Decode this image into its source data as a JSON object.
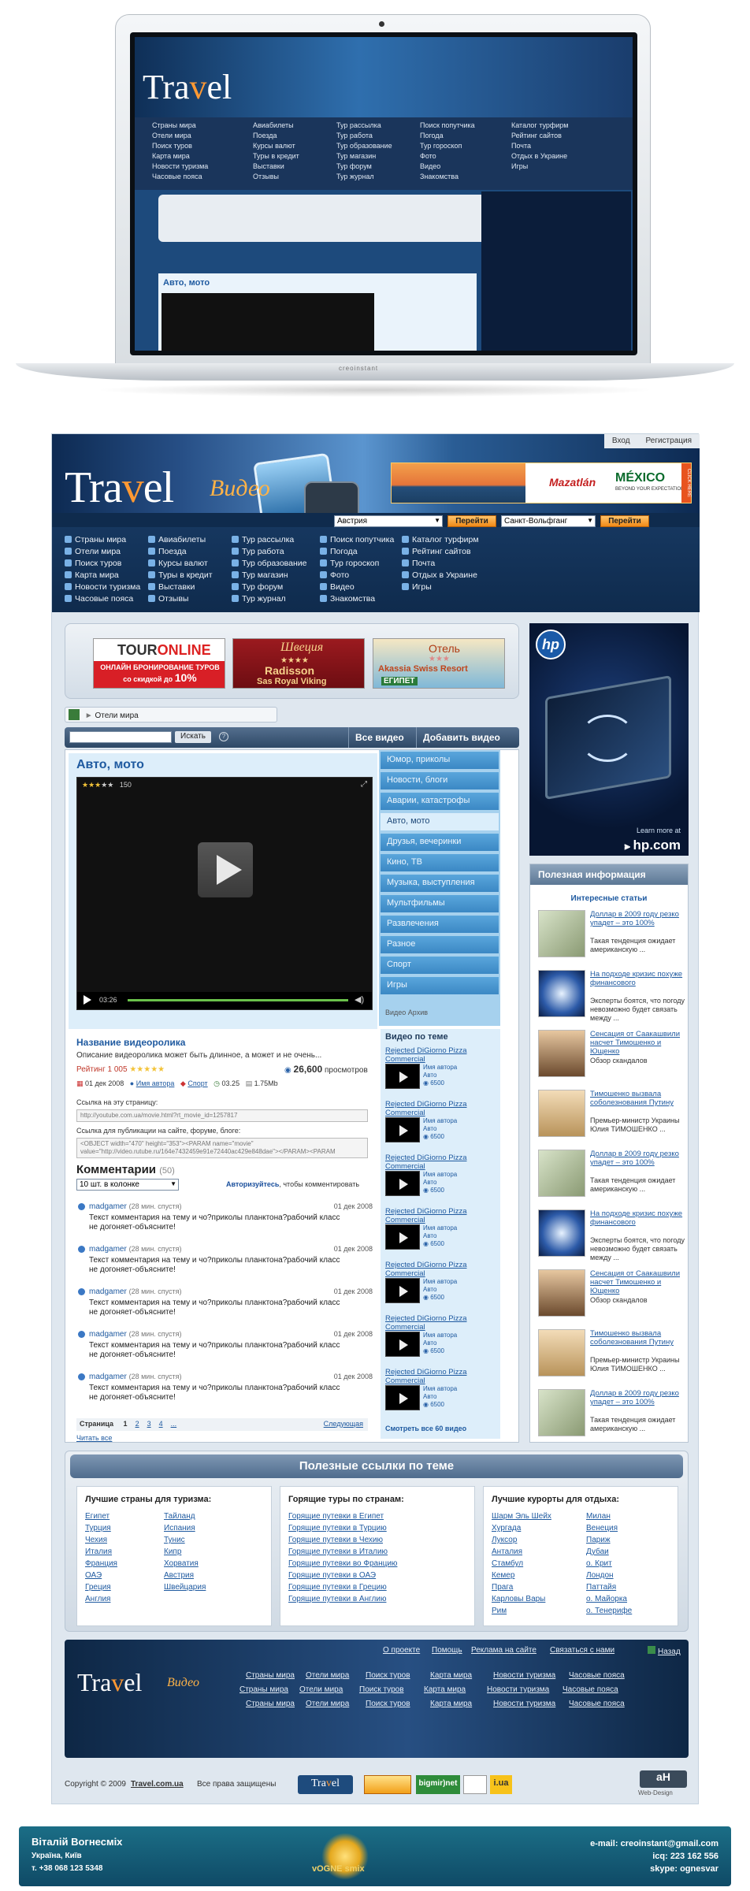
{
  "laptop": {
    "nav_left": [
      "Страны мира",
      "Отели мира",
      "Поиск туров",
      "Карта мира",
      "Новости туризма",
      "Часовые пояса"
    ],
    "nav_c2": [
      "Авиабилеты",
      "Поезда",
      "Курсы валют",
      "Туры в кредит",
      "Выставки",
      "Отзывы"
    ],
    "nav_c3": [
      "Тур рассылка",
      "Тур работа",
      "Тур образование",
      "Тур магазин",
      "Тур форум",
      "Тур журнал"
    ],
    "nav_c4": [
      "Поиск попутчика",
      "Погода",
      "Тур гороскоп",
      "Фото",
      "Видео",
      "Знакомства"
    ],
    "nav_c5": [
      "Каталог турфирм",
      "Рейтинг сайтов",
      "Почта",
      "Отдых в Украине",
      "Игры"
    ],
    "video_title": "Авто, мото",
    "brand": "creoinstant"
  },
  "toplinks": {
    "login": "Вход",
    "register": "Регистрация"
  },
  "logo": {
    "main": "Tra",
    "v": "v",
    "el": "el",
    "sub": "Видео"
  },
  "header_banner": {
    "brand1": "Mazatlán",
    "brand2": "MÉXICO",
    "tagline": "BEYOND YOUR EXPECTATIONS",
    "click": "CLICK HERE"
  },
  "search": {
    "country": "Австрия",
    "city": "Санкт-Вольфганг",
    "go1": "Перейти",
    "go2": "Перейти"
  },
  "nav": {
    "col1": [
      "Страны мира",
      "Отели мира",
      "Поиск туров",
      "Карта мира",
      "Новости туризма",
      "Часовые пояса"
    ],
    "col2": [
      "Авиабилеты",
      "Поезда",
      "Курсы валют",
      "Туры в кредит",
      "Выставки",
      "Отзывы"
    ],
    "col3": [
      "Тур рассылка",
      "Тур работа",
      "Тур образование",
      "Тур магазин",
      "Тур форум",
      "Тур журнал"
    ],
    "col4": [
      "Поиск попутчика",
      "Погода",
      "Тур гороскоп",
      "Фото",
      "Видео",
      "Знакомства"
    ],
    "col5": [
      "Каталог турфирм",
      "Рейтинг сайтов",
      "Почта",
      "Отдых в Украине",
      "Игры"
    ]
  },
  "banners": {
    "b1_title": "TOUR",
    "b1_title2": "ONLINE",
    "b1_text": "ОНЛАЙН БРОНИРОВАНИЕ ТУРОВ",
    "b1_sub": "со скидкой до",
    "b1_pct": "10%",
    "b2_title": "Швеция",
    "b2_stars": "★★★★",
    "b2_name": "Radisson",
    "b2_name2": "Sas Royal Viking",
    "b3_title": "Отель",
    "b3_stars": "★★★",
    "b3_name": "Akassia Swiss Resort",
    "b3_brand": "ЕГИПЕТ"
  },
  "hp": {
    "logo": "hp",
    "learn": "Learn more at",
    "site": "hp.com"
  },
  "breadcrumb": "Отели мира",
  "videobar": {
    "search_btn": "Искать",
    "tab1": "Все видео",
    "tab2": "Добавить видео"
  },
  "video": {
    "title": "Авто, мото",
    "views_top": "150",
    "time": "03:26"
  },
  "categories": [
    "Юмор, приколы",
    "Новости, блоги",
    "Аварии, катастрофы",
    "Авто, мото",
    "Друзья, вечеринки",
    "Кино, ТВ",
    "Музыка, выступления",
    "Мультфильмы",
    "Развлечения",
    "Разное",
    "Спорт",
    "Игры"
  ],
  "archive": "Видео Архив",
  "details": {
    "name": "Название видеоролика",
    "desc": "Описание видеоролика может быть длинное, а может и не очень...",
    "rating": "Рейтинг 1 005",
    "views": "26,600",
    "views_label": "просмотров",
    "date": "01 дек 2008",
    "author": "Имя автора",
    "category": "Спорт",
    "duration": "03.25",
    "size": "1.75Mb",
    "link_label": "Ссылка на эту страницу:",
    "link_value": "http://youtube.com.ua/movie.html?rt_movie_id=1257817",
    "embed_label": "Ссылка для публикации на сайте, форуме, блоге:",
    "embed_value": "<OBJECT width=\"470\" height=\"353\"><PARAM name=\"movie\" value=\"http://video.rutube.ru/164e7432459e91e72440ac429e848dae\"></PARAM><PARAM"
  },
  "comments": {
    "title": "Комментарии",
    "count": "(50)",
    "per_page": "10 шт. в колонке",
    "auth": "Авторизуйтесь",
    "auth_tail": ", чтобы комментировать",
    "items": [
      {
        "user": "madgamer",
        "ago": "(28 мин. спустя)",
        "date": "01 дек 2008",
        "text": "Текст комментария на тему и чо?приколы планктона?рабочий класс не догоняет-объясните!"
      },
      {
        "user": "madgamer",
        "ago": "(28 мин. спустя)",
        "date": "01 дек 2008",
        "text": "Текст комментария на тему и чо?приколы планктона?рабочий класс не догоняет-объясните!"
      },
      {
        "user": "madgamer",
        "ago": "(28 мин. спустя)",
        "date": "01 дек 2008",
        "text": "Текст комментария на тему и чо?приколы планктона?рабочий класс не догоняет-объясните!"
      },
      {
        "user": "madgamer",
        "ago": "(28 мин. спустя)",
        "date": "01 дек 2008",
        "text": "Текст комментария на тему и чо?приколы планктона?рабочий класс не догоняет-объясните!"
      },
      {
        "user": "madgamer",
        "ago": "(28 мин. спустя)",
        "date": "01 дек 2008",
        "text": "Текст комментария на тему и чо?приколы планктона?рабочий класс не догоняет-объясните!"
      }
    ],
    "page_label": "Страница",
    "pages": [
      "1",
      "2",
      "3",
      "4",
      "..."
    ],
    "next": "Следующая",
    "read_all": "Читать все"
  },
  "related": {
    "title": "Видео по теме",
    "item_title": "Rejected DiGiorno Pizza Commercial",
    "author": "Имя автора",
    "cat": "Авто",
    "views": "6500",
    "all": "Смотреть все 60 видео"
  },
  "info": {
    "title": "Полезная информация",
    "sub": "Интересные статьи",
    "items": [
      {
        "t": "Доллар в 2009 году резко упадет – это 100%",
        "s": "Такая тенденция ожидает американскую ...",
        "img": "money"
      },
      {
        "t": "На подходе кризис похуже финансового",
        "s": "Эксперты боятся, что погоду невозможно будет связать между ...",
        "img": "storm"
      },
      {
        "t": "Сенсация от Саакашвили насчет Тимошенко и Ющенко",
        "s": "Обзор скандалов",
        "img": "person"
      },
      {
        "t": "Тимошенко вызвала соболезнования Путину",
        "s": "Премьер-министр Украины Юлия ТИМОШЕНКО ...",
        "img": "woman"
      },
      {
        "t": "Доллар в 2009 году резко упадет – это 100%",
        "s": "Такая тенденция ожидает американскую ...",
        "img": "money"
      },
      {
        "t": "На подходе кризис похуже финансового",
        "s": "Эксперты боятся, что погоду невозможно будет связать между ...",
        "img": "storm"
      },
      {
        "t": "Сенсация от Саакашвили насчет Тимошенко и Ющенко",
        "s": "Обзор скандалов",
        "img": "person"
      },
      {
        "t": "Тимошенко вызвала соболезнования Путину",
        "s": "Премьер-министр Украины Юлия ТИМОШЕНКО ...",
        "img": "woman"
      },
      {
        "t": "Доллар в 2009 году резко упадет – это 100%",
        "s": "Такая тенденция ожидает американскую ...",
        "img": "money"
      }
    ]
  },
  "links": {
    "title": "Полезные ссылки по теме",
    "c1_title": "Лучшие страны для туризма:",
    "c1a": [
      "Египет",
      "Турция",
      "Чехия",
      "Италия",
      "Франция",
      "ОАЭ",
      "Греция",
      "Англия"
    ],
    "c1b": [
      "Тайланд",
      "Испания",
      "Тунис",
      "Кипр",
      "Хорватия",
      "Австрия",
      "Швейцария"
    ],
    "c2_title": "Горящие туры по странам:",
    "c2": [
      "Горящие путевки в Египет",
      "Горящие путевки в Турцию",
      "Горящие путевки в Чехию",
      "Горящие путевки в Италию",
      "Горящие путевки во Францию",
      "Горящие путевки в ОАЭ",
      "Горящие путевки в Грецию",
      "Горящие путевки в Англию"
    ],
    "c3_title": "Лучшие курорты для отдыха:",
    "c3a": [
      "Шарм Эль Шейх",
      "Хургада",
      "Луксор",
      "Анталия",
      "Стамбул",
      "Кемер",
      "Прага",
      "Карловы Вары",
      "Рим"
    ],
    "c3b": [
      "Милан",
      "Венеция",
      "Париж",
      "Дубаи",
      "о. Крит",
      "Лондон",
      "Паттайя",
      "о. Майорка",
      "о. Тенерифе"
    ]
  },
  "footer": {
    "top": [
      "О проекте",
      "Помощь",
      "Реклама на сайте",
      "Связаться с нами"
    ],
    "back": "Назад",
    "row1": [
      "Страны мира",
      "Отели мира",
      "Поиск туров",
      "Карта мира",
      "Новости туризма",
      "Часовые пояса"
    ],
    "row2": [
      "Страны мира",
      "Отели мира",
      "Поиск туров",
      "Карта мира",
      "Новости туризма",
      "Часовые пояса"
    ],
    "row3": [
      "Страны мира",
      "Отели мира",
      "Поиск туров",
      "Карта мира",
      "Новости туризма",
      "Часовые пояса"
    ],
    "copyright": "Copyright © 2009",
    "site": "Travel.com.ua",
    "rights": "Все права защищены",
    "counter1": "bigmir)net",
    "counter2": "i.ua",
    "webdesign": "Web-Design"
  },
  "author": {
    "name": "Віталій Вогнесміх",
    "city": "Україна, Київ",
    "phone": "т. +38 068 123 5348",
    "brand": "vOGNE",
    "brand2": "smix",
    "email": "e-mail: creoinstant@gmail.com",
    "icq": "icq: 223 162 556",
    "skype": "skype: ognesvar"
  }
}
